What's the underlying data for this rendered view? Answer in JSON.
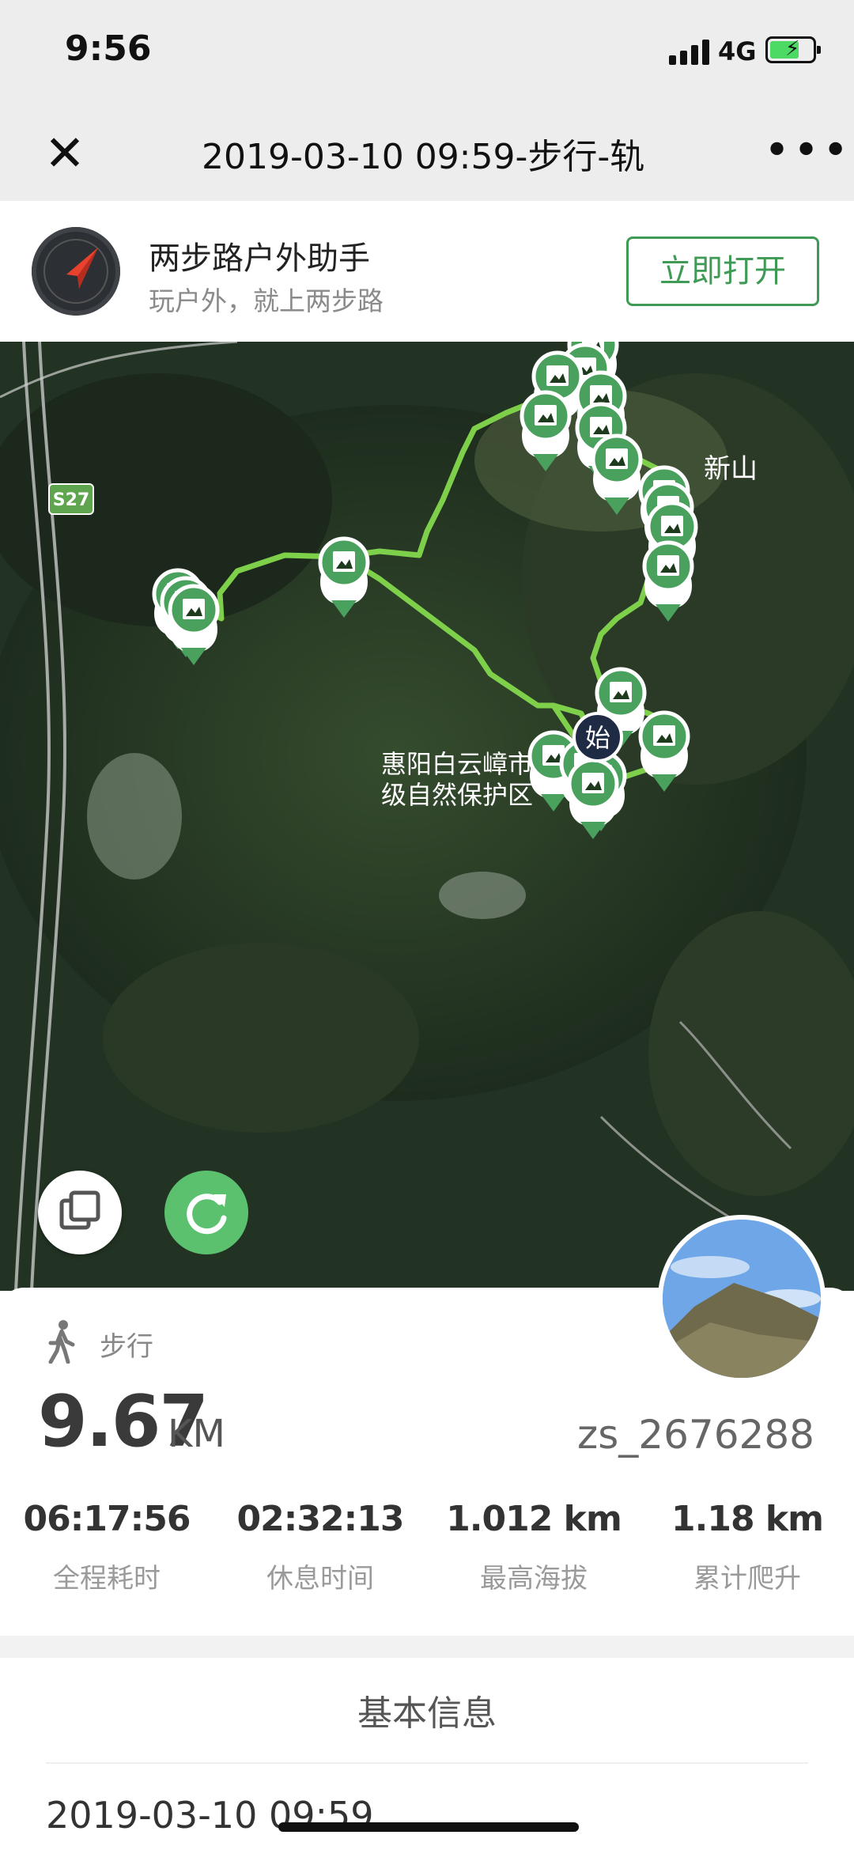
{
  "status": {
    "time": "9:56",
    "network": "4G"
  },
  "titlebar": {
    "title": "2019-03-10 09:59-步行-轨",
    "close_icon": "close-icon",
    "more_icon": "more-icon"
  },
  "banner": {
    "app_name": "两步路户外助手",
    "slogan": "玩户外，就上两步路",
    "open_label": "立即打开"
  },
  "map": {
    "road_label": "S27",
    "peak_label": "新山",
    "reserve_label_line1": "惠阳白云嶂市",
    "reserve_label_line2": "级自然保护区",
    "start_label": "始",
    "track_color": "#7ed04b",
    "marker_color": "#4aa05d"
  },
  "activity": {
    "mode": "步行",
    "distance": "9.67",
    "distance_unit": "KM",
    "username": "zs_2676288",
    "stats": [
      {
        "value": "06:17:56",
        "label": "全程耗时"
      },
      {
        "value": "02:32:13",
        "label": "休息时间"
      },
      {
        "value": "1.012 km",
        "label": "最高海拔"
      },
      {
        "value": "1.18 km",
        "label": "累计爬升"
      }
    ]
  },
  "basic_info": {
    "title": "基本信息",
    "date": "2019-03-10 09:59"
  }
}
